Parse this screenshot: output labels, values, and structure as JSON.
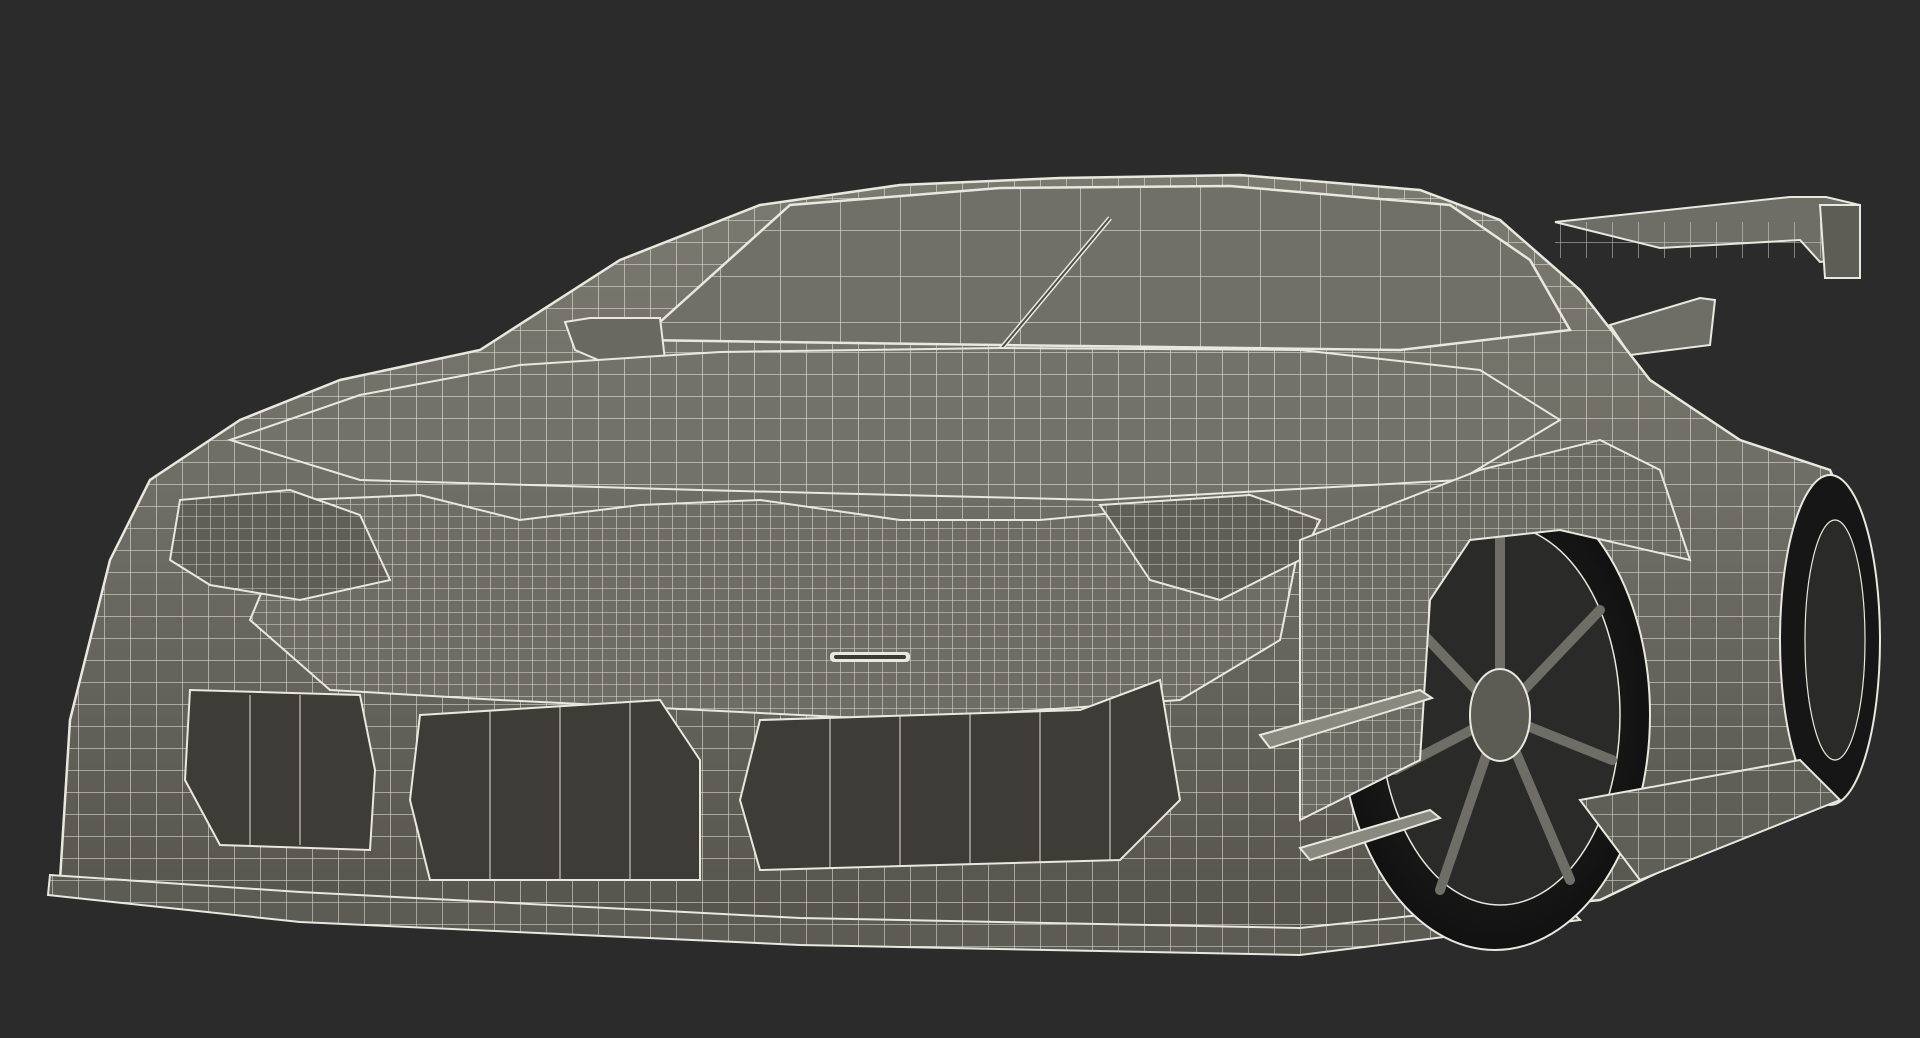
{
  "scene": {
    "subject": "race-car-wireframe-render",
    "colors": {
      "background": "#2b2b2b",
      "surface": "#6f6e66",
      "surface_light": "#8a8980",
      "surface_dark": "#4c4b45",
      "wire": "#e9e8de",
      "tire": "#1a1a1a",
      "cavity": "#3a3a36"
    }
  }
}
